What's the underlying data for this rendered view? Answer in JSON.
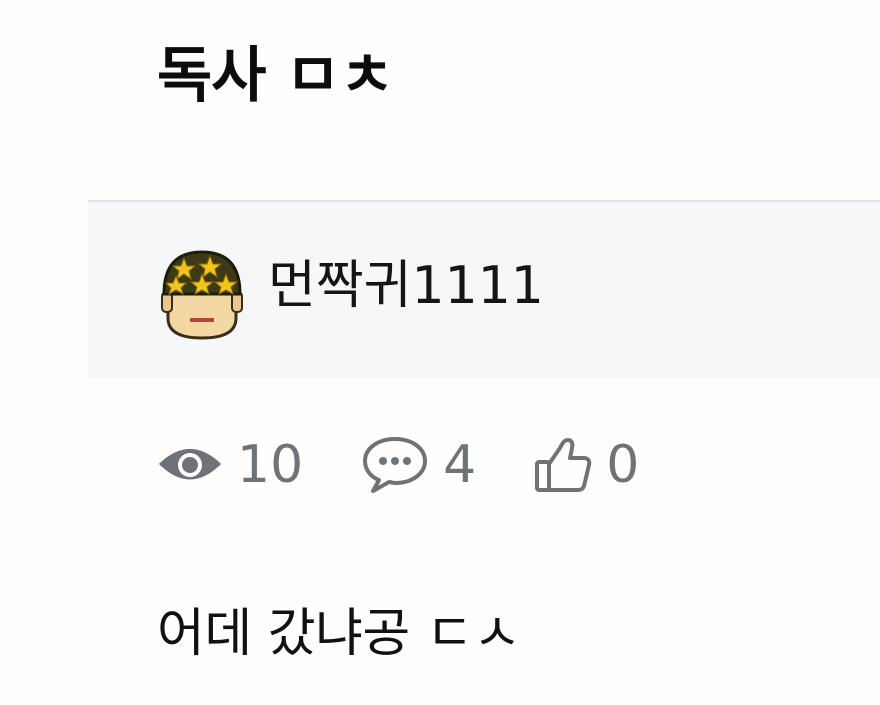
{
  "post": {
    "title": "독사 ㅁㅊ",
    "author": "먼짝귀1111",
    "body": "어데 갔냐공 ㄷㅅ"
  },
  "stats": {
    "views": "10",
    "comments": "4",
    "likes": "0"
  },
  "icons": {
    "avatar": "soldier-helmet-stars-avatar",
    "views": "eye-icon",
    "comments": "speech-bubble-icon",
    "likes": "thumbs-up-icon"
  },
  "colors": {
    "author_bar_bg": "#f6f7f9",
    "stat_gray": "#6f7378"
  }
}
